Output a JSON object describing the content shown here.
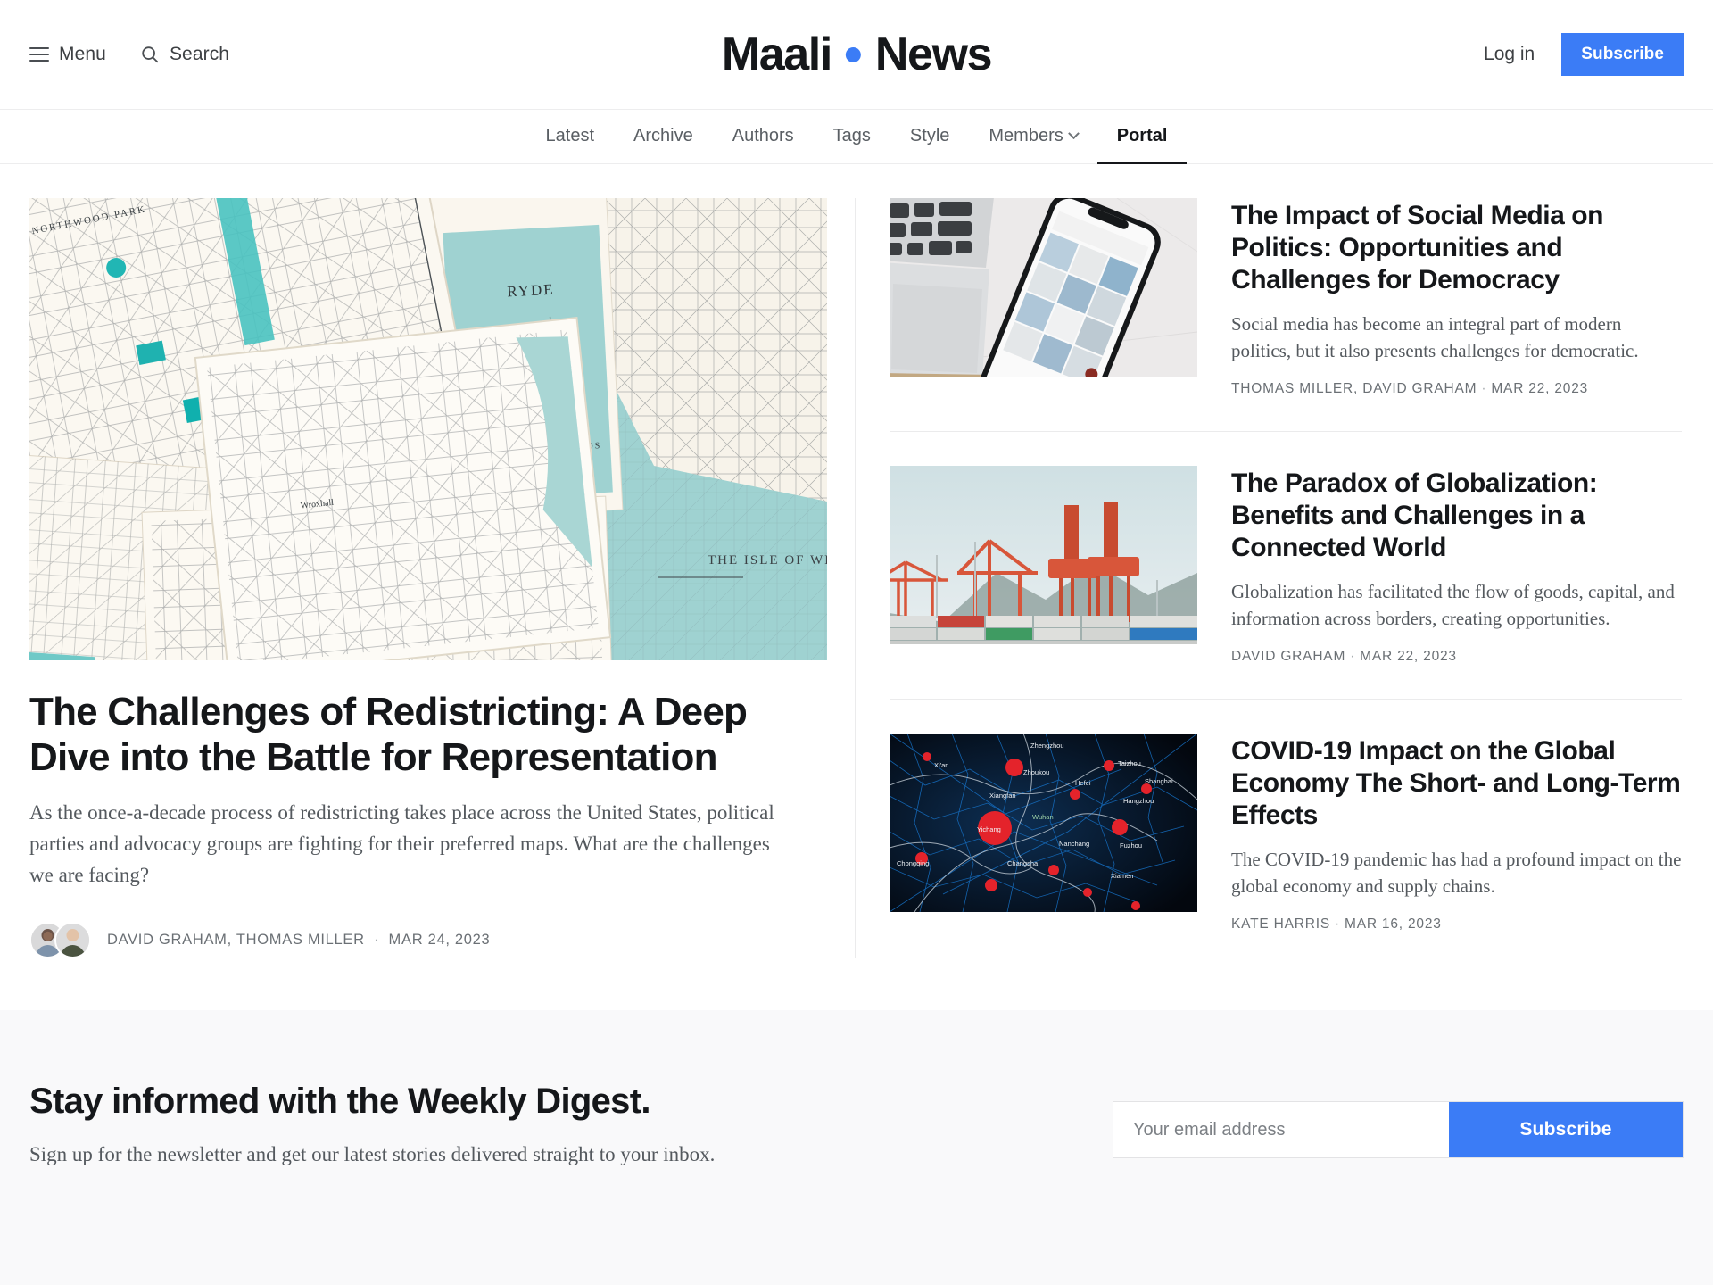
{
  "header": {
    "menu_label": "Menu",
    "search_label": "Search",
    "brand_primary": "Maali",
    "brand_secondary": "News",
    "login_label": "Log in",
    "subscribe_label": "Subscribe",
    "accent_color": "#3b7cf6"
  },
  "nav": {
    "items": [
      {
        "label": "Latest",
        "active": false,
        "has_dropdown": false
      },
      {
        "label": "Archive",
        "active": false,
        "has_dropdown": false
      },
      {
        "label": "Authors",
        "active": false,
        "has_dropdown": false
      },
      {
        "label": "Tags",
        "active": false,
        "has_dropdown": false
      },
      {
        "label": "Style",
        "active": false,
        "has_dropdown": false
      },
      {
        "label": "Members",
        "active": false,
        "has_dropdown": true
      },
      {
        "label": "Portal",
        "active": true,
        "has_dropdown": false
      }
    ]
  },
  "feature": {
    "image_alt": "vintage-folded-paper-maps-isle-of-wight",
    "title": "The Challenges of Redistricting: A Deep Dive into the Battle for Representation",
    "excerpt": "As the once-a-decade process of redistricting takes place across the United States, political parties and advocacy groups are fighting for their preferred maps. What are the challenges we are facing?",
    "authors": "DAVID GRAHAM, THOMAS MILLER",
    "date": "MAR 24, 2023",
    "avatar_count": 2
  },
  "list": {
    "items": [
      {
        "image_alt": "laptop-keyboard-and-smartphone-on-marble",
        "title": "The Impact of Social Media on Politics: Opportunities and Challenges for Democracy",
        "excerpt": "Social media has become an integral part of modern politics, but it also presents challenges for democratic.",
        "authors": "THOMAS MILLER, DAVID GRAHAM",
        "date": "MAR 22, 2023"
      },
      {
        "image_alt": "shipping-container-port-with-orange-cranes",
        "title": "The Paradox of Globalization: Benefits and Challenges in a Connected World",
        "excerpt": "Globalization has facilitated the flow of goods, capital, and information across borders, creating opportunities.",
        "authors": "DAVID GRAHAM",
        "date": "MAR 22, 2023"
      },
      {
        "image_alt": "dark-data-map-of-china-with-red-outbreak-markers",
        "title": "COVID-19 Impact on the Global Economy The Short- and Long-Term Effects",
        "excerpt": "The COVID-19 pandemic has had a profound impact on the global economy and supply chains.",
        "authors": "KATE HARRIS",
        "date": "MAR 16, 2023"
      }
    ]
  },
  "newsletter": {
    "title": "Stay informed with the Weekly Digest.",
    "subtitle": "Sign up for the newsletter and get our latest stories delivered straight to your inbox.",
    "email_placeholder": "Your email address",
    "email_value": "",
    "subscribe_label": "Subscribe"
  }
}
